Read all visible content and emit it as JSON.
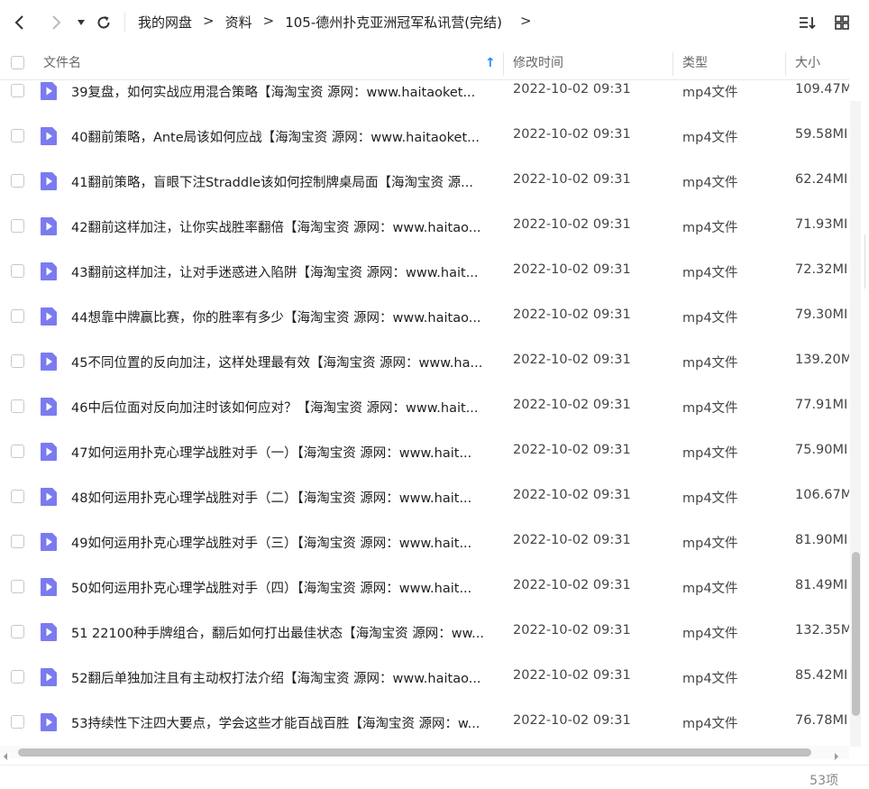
{
  "toolbar": {
    "breadcrumbs": [
      "我的网盘",
      "资料",
      "105-德州扑克亚洲冠军私讯营(完结)"
    ],
    "separator": ">",
    "trailing_arrow": ">",
    "icons": [
      "back-arrow-icon",
      "forward-arrow-icon",
      "dropdown-caret-icon",
      "refresh-icon",
      "sort-icon",
      "grid-view-icon"
    ]
  },
  "header": {
    "name": "文件名",
    "modified": "修改时间",
    "type": "类型",
    "size": "大小",
    "sort_indicator": "↑"
  },
  "colors": {
    "accent": "#1a8cff",
    "file_icon": "#7b7bf0"
  },
  "files": [
    {
      "name": "39复盘，如何实战应用混合策略【海淘宝资 源网：www.haitaoket...",
      "date": "2022-10-02 09:31",
      "type": "mp4文件",
      "size": "109.47M"
    },
    {
      "name": "40翻前策略，Ante局该如何应战【海淘宝资 源网：www.haitaoket...",
      "date": "2022-10-02 09:31",
      "type": "mp4文件",
      "size": "59.58MI"
    },
    {
      "name": "41翻前策略，盲眼下注Straddle该如何控制牌桌局面【海淘宝资 源...",
      "date": "2022-10-02 09:31",
      "type": "mp4文件",
      "size": "62.24MI"
    },
    {
      "name": "42翻前这样加注，让你实战胜率翻倍【海淘宝资 源网：www.haitao...",
      "date": "2022-10-02 09:31",
      "type": "mp4文件",
      "size": "71.93MI"
    },
    {
      "name": "43翻前这样加注，让对手迷惑进入陷阱【海淘宝资 源网：www.hait...",
      "date": "2022-10-02 09:31",
      "type": "mp4文件",
      "size": "72.32MI"
    },
    {
      "name": "44想靠中牌赢比赛，你的胜率有多少【海淘宝资 源网：www.haitao...",
      "date": "2022-10-02 09:31",
      "type": "mp4文件",
      "size": "79.30MI"
    },
    {
      "name": "45不同位置的反向加注，这样处理最有效【海淘宝资 源网：www.ha...",
      "date": "2022-10-02 09:31",
      "type": "mp4文件",
      "size": "139.20M"
    },
    {
      "name": "46中后位面对反向加注时该如何应对？【海淘宝资 源网：www.hait...",
      "date": "2022-10-02 09:31",
      "type": "mp4文件",
      "size": "77.91MI"
    },
    {
      "name": "47如何运用扑克心理学战胜对手（一）【海淘宝资 源网：www.hait...",
      "date": "2022-10-02 09:31",
      "type": "mp4文件",
      "size": "75.90MI"
    },
    {
      "name": "48如何运用扑克心理学战胜对手（二）【海淘宝资 源网：www.hait...",
      "date": "2022-10-02 09:31",
      "type": "mp4文件",
      "size": "106.67M"
    },
    {
      "name": "49如何运用扑克心理学战胜对手（三）【海淘宝资 源网：www.hait...",
      "date": "2022-10-02 09:31",
      "type": "mp4文件",
      "size": "81.90MI"
    },
    {
      "name": "50如何运用扑克心理学战胜对手（四）【海淘宝资 源网：www.hait...",
      "date": "2022-10-02 09:31",
      "type": "mp4文件",
      "size": "81.49MI"
    },
    {
      "name": "51 22100种手牌组合，翻后如何打出最佳状态【海淘宝资 源网：ww...",
      "date": "2022-10-02 09:31",
      "type": "mp4文件",
      "size": "132.35M"
    },
    {
      "name": "52翻后单独加注且有主动权打法介绍【海淘宝资 源网：www.haitao...",
      "date": "2022-10-02 09:31",
      "type": "mp4文件",
      "size": "85.42MI"
    },
    {
      "name": "53持续性下注四大要点，学会这些才能百战百胜【海淘宝资 源网：w...",
      "date": "2022-10-02 09:31",
      "type": "mp4文件",
      "size": "76.78MI"
    }
  ],
  "footer": {
    "count": "53项"
  }
}
